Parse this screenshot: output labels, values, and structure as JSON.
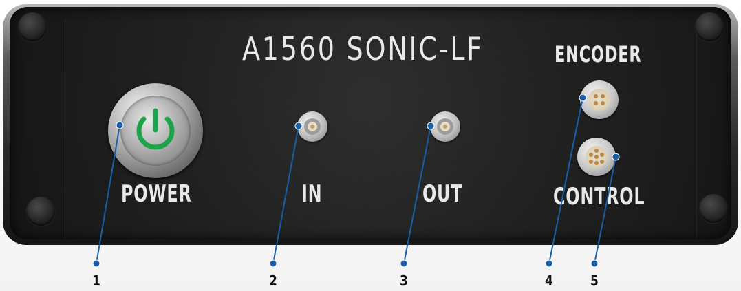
{
  "device": {
    "title": "A1560 SONIC-LF"
  },
  "labels": {
    "power": "POWER",
    "in": "IN",
    "out": "OUT",
    "encoder": "ENCODER",
    "control": "CONTROL"
  },
  "callouts": [
    "1",
    "2",
    "3",
    "4",
    "5"
  ],
  "colors": {
    "callout": "#1a5ea8",
    "power_icon": "#1fa34a",
    "panel": "#1f1f1f"
  },
  "icons": {
    "power": "power-icon"
  }
}
